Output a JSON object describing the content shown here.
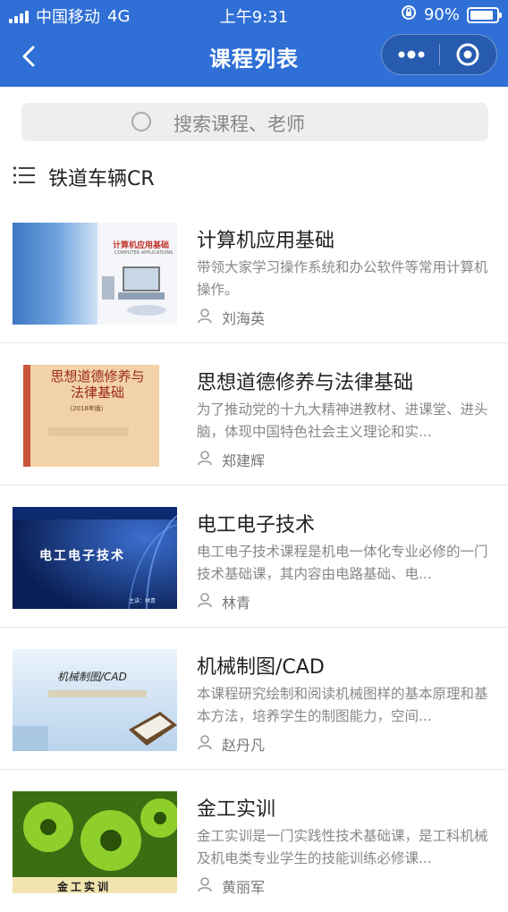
{
  "status_bar": {
    "carrier": "中国移动",
    "network": "4G",
    "time": "上午9:31",
    "battery_text": "90%",
    "battery_level": 0.9
  },
  "navbar": {
    "title": "课程列表",
    "back_icon": "chevron-left-icon",
    "more_icon": "more-dots-icon",
    "close_icon": "target-icon"
  },
  "search": {
    "placeholder": "搜索课程、老师",
    "icon": "search-icon"
  },
  "category": {
    "icon": "list-icon",
    "label": "铁道车辆CR"
  },
  "courses": [
    {
      "title": "计算机应用基础",
      "description": "带领大家学习操作系统和办公软件等常用计算机操作。",
      "teacher": "刘海英",
      "thumb_text": "计算机应用基础",
      "thumb_subtext": "COMPUTER APPLICATIONS"
    },
    {
      "title": "思想道德修养与法律基础",
      "description": "为了推动党的十九大精神进教材、进课堂、进头脑，体现中国特色社会主义理论和实...",
      "teacher": "郑建辉",
      "thumb_text": "思想道德修养与法律基础",
      "thumb_subtext": "（2018年版）"
    },
    {
      "title": "电工电子技术",
      "description": "电工电子技术课程是机电一体化专业必修的一门技术基础课，其内容由电路基础、电...",
      "teacher": "林青",
      "thumb_text": "电工电子技术",
      "thumb_subtext": "主讲：林青"
    },
    {
      "title": "机械制图/CAD",
      "description": "本课程研究绘制和阅读机械图样的基本原理和基本方法，培养学生的制图能力，空间...",
      "teacher": "赵丹凡",
      "thumb_text": "机械制图/CAD",
      "thumb_subtext": ""
    },
    {
      "title": "金工实训",
      "description": "金工实训是一门实践性技术基础课，是工科机械及机电类专业学生的技能训练必修课...",
      "teacher": "黄丽军",
      "thumb_text": "金工实训",
      "thumb_subtext": ""
    }
  ],
  "colors": {
    "header_bg": "#2f6fd6",
    "search_bg": "#eeeeee",
    "title_text": "#222222",
    "desc_text": "#888888"
  }
}
